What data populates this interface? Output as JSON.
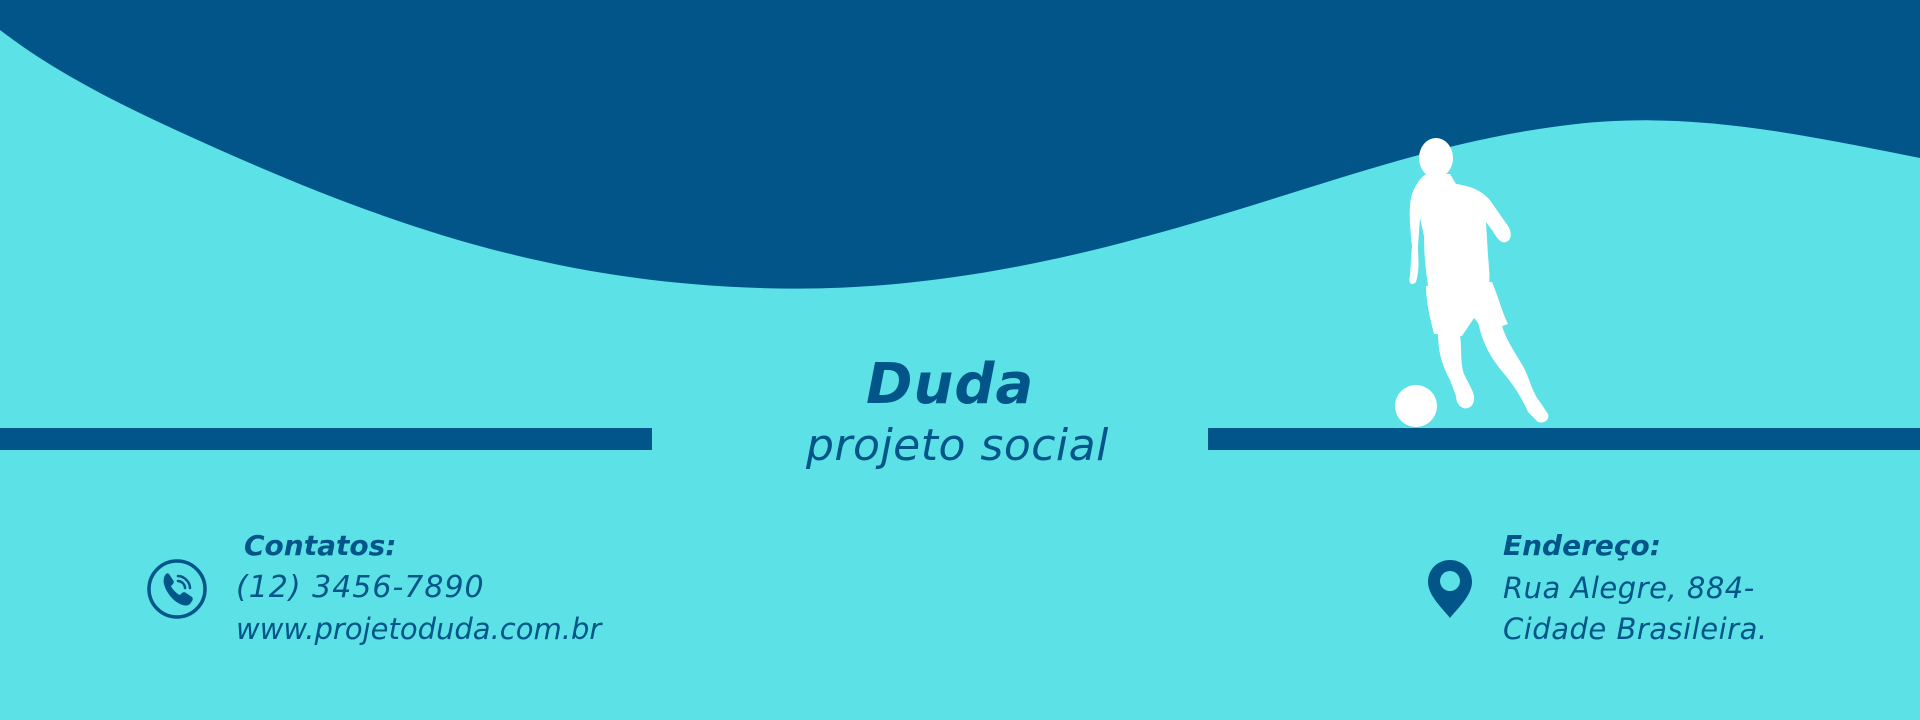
{
  "colors": {
    "background": "#5ce1e6",
    "accent": "#015588",
    "figure": "#ffffff"
  },
  "brand": {
    "name": "Duda",
    "tagline": "projeto social"
  },
  "contacts": {
    "label": "Contatos:",
    "phone": "(12) 3456-7890",
    "website": "www.projetoduda.com.br",
    "icon": "phone-icon"
  },
  "address": {
    "label": "Endereço:",
    "line1": "Rua Alegre, 884-",
    "line2": "Cidade Brasileira.",
    "icon": "location-pin-icon"
  },
  "illustration": {
    "subject": "soccer-player-silhouette-icon"
  }
}
